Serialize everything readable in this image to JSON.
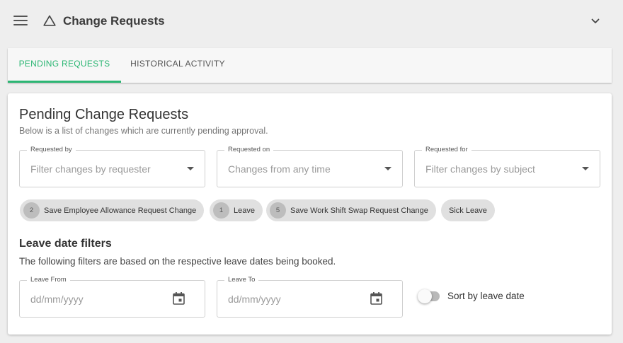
{
  "header": {
    "title": "Change Requests",
    "menu_icon": "hamburger-menu-icon",
    "title_icon": "warning-triangle-icon",
    "collapse_icon": "chevron-down-icon"
  },
  "tabs": [
    {
      "label": "PENDING REQUESTS",
      "active": true
    },
    {
      "label": "HISTORICAL ACTIVITY",
      "active": false
    }
  ],
  "main": {
    "title": "Pending Change Requests",
    "subtitle": "Below is a list of changes which are currently pending approval.",
    "filters": [
      {
        "label": "Requested by",
        "placeholder": "Filter changes by requester"
      },
      {
        "label": "Requested on",
        "placeholder": "Changes from any time"
      },
      {
        "label": "Requested for",
        "placeholder": "Filter changes by subject"
      }
    ],
    "chips": [
      {
        "count": "2",
        "label": "Save Employee Allowance Request Change"
      },
      {
        "count": "1",
        "label": "Leave"
      },
      {
        "count": "5",
        "label": "Save Work Shift Swap Request Change"
      },
      {
        "count": "",
        "label": "Sick Leave"
      }
    ],
    "leave_section": {
      "title": "Leave date filters",
      "description": "The following filters are based on the respective leave dates being booked.",
      "from": {
        "label": "Leave From",
        "placeholder": "dd/mm/yyyy"
      },
      "to": {
        "label": "Leave To",
        "placeholder": "dd/mm/yyyy"
      },
      "sort_toggle": {
        "label": "Sort by leave date",
        "on": false
      }
    }
  },
  "colors": {
    "accent": "#2bb673",
    "background": "#eeeeee",
    "card": "#ffffff",
    "chip": "#e0e0e0"
  }
}
